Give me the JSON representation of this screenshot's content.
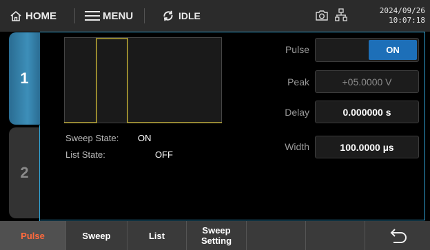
{
  "topbar": {
    "home_label": "HOME",
    "menu_label": "MENU",
    "status_label": "IDLE",
    "date": "2024/09/26",
    "time": "10:07:18",
    "icons": [
      "home-icon",
      "menu-icon",
      "refresh-icon",
      "camera-icon",
      "network-icon"
    ]
  },
  "channels": [
    {
      "label": "1",
      "active": true
    },
    {
      "label": "2",
      "active": false
    }
  ],
  "info": {
    "sweep_state_label": "Sweep State:",
    "sweep_state_value": "ON",
    "list_state_label": "List State:",
    "list_state_value": "OFF"
  },
  "params": {
    "pulse_label": "Pulse",
    "pulse_toggle": "ON",
    "peak_label": "Peak",
    "peak_value": "+05.0000 V",
    "delay_label": "Delay",
    "delay_value": "0.000000 s",
    "width_label": "Width",
    "width_value": "100.0000 µs"
  },
  "softkeys": {
    "pulse": "Pulse",
    "sweep": "Sweep",
    "list": "List",
    "sweep_setting_line1": "Sweep",
    "sweep_setting_line2": "Setting",
    "selected": "Pulse"
  },
  "colors": {
    "accent": "#2f9fd0",
    "toggle_on": "#1d6fb8",
    "selected_softkey_text": "#ff6a3d",
    "pulse_trace": "#d8c23a"
  }
}
